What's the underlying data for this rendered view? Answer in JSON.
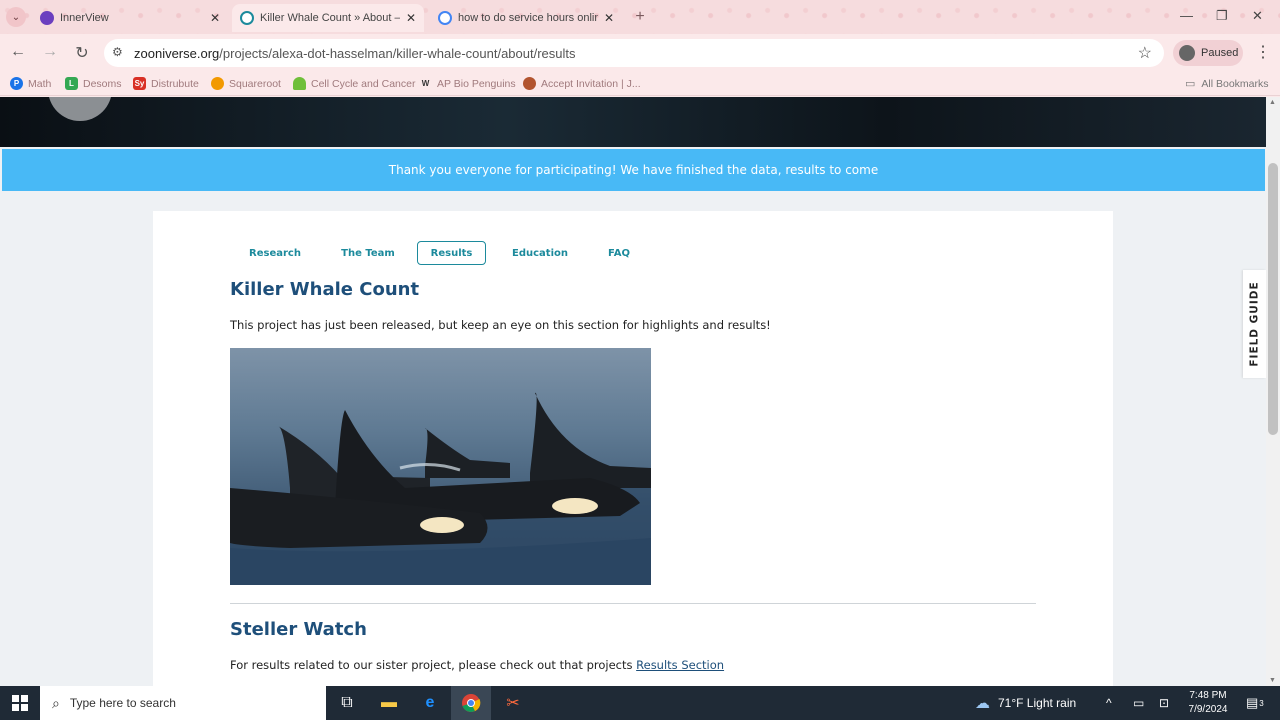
{
  "tabs": [
    {
      "title": "InnerView",
      "favicon_color": "#6b3fbf"
    },
    {
      "title": "Killer Whale Count » About — Z",
      "favicon_color": "#1c8a9c"
    },
    {
      "title": "how to do service hours online",
      "favicon_color": "#4285f4"
    }
  ],
  "toolbar": {
    "url_host": "zooniverse.org",
    "url_path": "/projects/alexa-dot-hasselman/killer-whale-count/about/results",
    "profile_label": "Paused"
  },
  "bookmarks": [
    {
      "label": "Math",
      "color": "#1a73e8",
      "glyph": "P"
    },
    {
      "label": "Desoms",
      "color": "#34a853",
      "glyph": "L"
    },
    {
      "label": "Distrubute",
      "color": "#d93025",
      "glyph": "Sy"
    },
    {
      "label": "Squareroot",
      "color": "#f29900",
      "glyph": "✹"
    },
    {
      "label": "Cell Cycle and Cancer",
      "color": "#6fbf3a",
      "glyph": ""
    },
    {
      "label": "AP Bio Penguins",
      "color": "#555555",
      "glyph": "W"
    },
    {
      "label": "Accept Invitation | J...",
      "color": "#b2542f",
      "glyph": "●"
    }
  ],
  "all_bookmarks": "All Bookmarks",
  "banner": "Thank you everyone for participating! We have finished the data, results to come",
  "subnav": [
    "Research",
    "The Team",
    "Results",
    "Education",
    "FAQ"
  ],
  "subnav_active": "Results",
  "section1": {
    "title": "Killer Whale Count",
    "text": "This project has just been released, but keep an eye on this section for highlights and results!"
  },
  "section2": {
    "title": "Steller Watch",
    "text": "For results related to our sister project, please check out that projects",
    "link": "Results Section"
  },
  "field_guide": "FIELD GUIDE",
  "taskbar": {
    "search_placeholder": "Type here to search",
    "weather": "71°F  Light rain",
    "time": "7:48 PM",
    "date": "7/9/2024",
    "notifications": "3"
  }
}
